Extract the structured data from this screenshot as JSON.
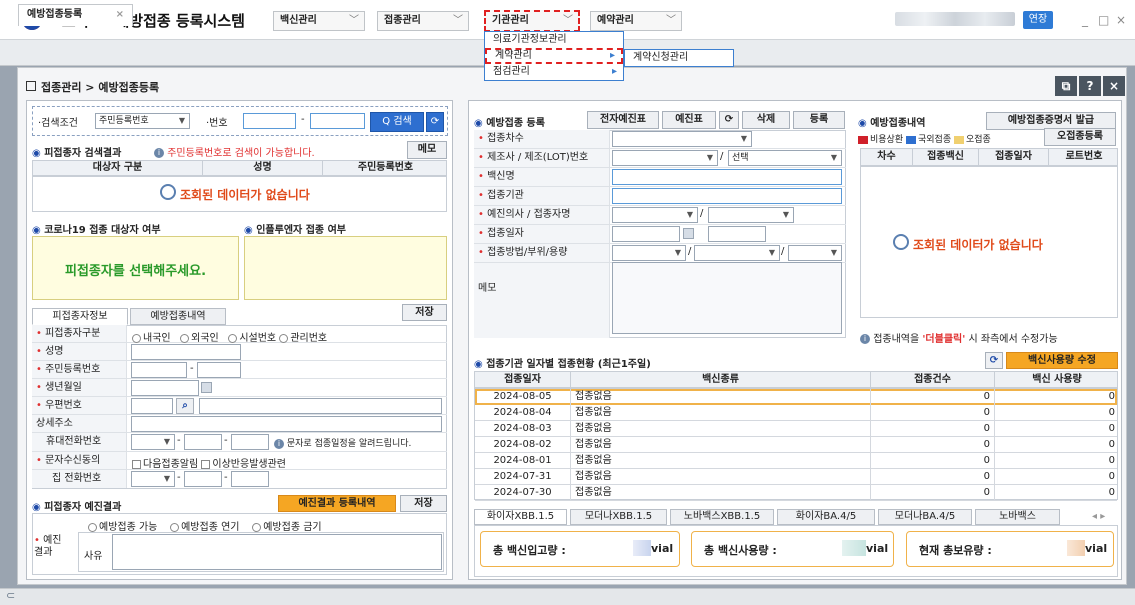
{
  "titlebar": {
    "app_title": "코로나19 예방접종 등록시스템",
    "menus": [
      "백신관리",
      "접종관리",
      "기관관리",
      "예약관리"
    ],
    "extend_label": "연장",
    "minimize": "_",
    "close": "□",
    "x": "×"
  },
  "dropdown": {
    "items": [
      "의료기관정보관리",
      "계약관리",
      "점검관리"
    ],
    "submenu": "계약신청관리"
  },
  "tabs": {
    "page": "예방접종등록"
  },
  "breadcrumb": "접종관리 > 예방접종등록",
  "topicons": [
    "⧉",
    "?",
    "×"
  ],
  "search": {
    "condition_label": "·검색조건",
    "condition_value": "주민등록번호",
    "number_label": "·번호",
    "dash": "-",
    "search_btn": "Q 검색"
  },
  "result": {
    "title": "피접종자 검색결과",
    "hint": "주민등록번호로 검색이 가능합니다.",
    "memo_btn": "메모",
    "headers": [
      "대상자 구분",
      "성명",
      "주민등록번호"
    ],
    "nodata": "조회된 데이터가 없습니다"
  },
  "target": {
    "covid_title": "코로나19 접종 대상자 여부",
    "flu_title": "인플루엔자 접종 여부",
    "select_msg": "피접종자를 선택해주세요."
  },
  "person": {
    "tabs": [
      "피접종자정보",
      "예방접종내역"
    ],
    "save_btn": "저장",
    "fields": {
      "type_label": "피접종자구분",
      "type_opts": [
        "내국인",
        "외국인",
        "시설번호",
        "관리번호"
      ],
      "name_label": "성명",
      "rrn_label": "주민등록번호",
      "birth_label": "생년월일",
      "zip_label": "우편번호",
      "addr_label": "상세주소",
      "mobile_label": "휴대전화번호",
      "mobile_hint": "문자로 접종일정을 알려드립니다.",
      "sms_label": "문자수신동의",
      "sms_opts": [
        "다음접종알림",
        "이상반응발생관련"
      ],
      "home_label": "집 전화번호"
    }
  },
  "prescreen": {
    "title": "피접종자 예진결과",
    "history_btn": "예진결과 등록내역",
    "save_btn": "저장",
    "opts": [
      "예방접종 가능",
      "예방접종 연기",
      "예방접종 금기"
    ],
    "result_label": "예진\n결과",
    "reason_label": "사유"
  },
  "register": {
    "title": "예방접종 등록",
    "buttons": [
      "전자예진표",
      "예진표",
      "⟳",
      "삭제",
      "등록"
    ],
    "fields": [
      "접종차수",
      "제조사 / 제조(LOT)번호",
      "백신명",
      "접종기관",
      "예진의사 / 접종자명",
      "접종일자",
      "접종방법/부위/용량"
    ],
    "select_label": "선택",
    "memo_label": "메모"
  },
  "history": {
    "title": "예방접종내역",
    "cert_btn": "예방접종증명서 발급",
    "legend": [
      "비용상환",
      "국외접종",
      "오접종"
    ],
    "legend_colors": [
      "#d0202a",
      "#2e6fd0",
      "#f0d070"
    ],
    "error_btn": "오접종등록",
    "headers": [
      "차수",
      "접종백신",
      "접종일자",
      "로트번호"
    ],
    "nodata": "조회된 데이터가 없습니다",
    "hint_pre": "접종내역을 ",
    "hint_em": "'더블클릭'",
    "hint_post": " 시 좌측에서 수정가능"
  },
  "daily": {
    "title": "접종기관 일자별 접종현황 (최근1주일)",
    "usage_btn": "백신사용량 수정",
    "headers": [
      "접종일자",
      "백신종류",
      "접종건수",
      "백신 사용량"
    ],
    "rows": [
      {
        "date": "2024-08-05",
        "type": "접종없음",
        "count": "0",
        "usage": "0"
      },
      {
        "date": "2024-08-04",
        "type": "접종없음",
        "count": "0",
        "usage": "0"
      },
      {
        "date": "2024-08-03",
        "type": "접종없음",
        "count": "0",
        "usage": "0"
      },
      {
        "date": "2024-08-02",
        "type": "접종없음",
        "count": "0",
        "usage": "0"
      },
      {
        "date": "2024-08-01",
        "type": "접종없음",
        "count": "0",
        "usage": "0"
      },
      {
        "date": "2024-07-31",
        "type": "접종없음",
        "count": "0",
        "usage": "0"
      },
      {
        "date": "2024-07-30",
        "type": "접종없음",
        "count": "0",
        "usage": "0"
      }
    ]
  },
  "vaccinetabs": [
    "화이자XBB.1.5",
    "모더나XBB.1.5",
    "노바백스XBB.1.5",
    "화이자BA.4/5",
    "모더나BA.4/5",
    "노바백스"
  ],
  "stats": [
    {
      "label": "총 백신입고량 :",
      "unit": "vial"
    },
    {
      "label": "총 백신사용량 :",
      "unit": "vial"
    },
    {
      "label": "현재 총보유량 :",
      "unit": "vial"
    }
  ]
}
